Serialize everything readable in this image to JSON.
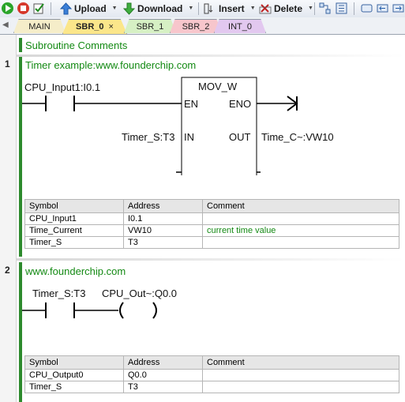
{
  "toolbar": {
    "upload_label": "Upload",
    "download_label": "Download",
    "insert_label": "Insert",
    "delete_label": "Delete"
  },
  "tabs": [
    {
      "label": "MAIN",
      "color": "#f5edc9",
      "active": false
    },
    {
      "label": "SBR_0",
      "color": "#fbe68a",
      "active": true,
      "close": "×"
    },
    {
      "label": "SBR_1",
      "color": "#d6f0c4",
      "active": false
    },
    {
      "label": "SBR_2",
      "color": "#f7c6cc",
      "active": false
    },
    {
      "label": "INT_0",
      "color": "#e2c8ef",
      "active": false
    }
  ],
  "subroutine_comment": "Subroutine Comments",
  "networks": [
    {
      "number": "1",
      "comment": "Timer example:www.founderchip.com",
      "contact_label": "CPU_Input1:I0.1",
      "box_title": "MOV_W",
      "pin_en": "EN",
      "pin_eno": "ENO",
      "pin_in": "IN",
      "pin_out": "OUT",
      "in_operand": "Timer_S:T3",
      "out_operand": "Time_C~:VW10",
      "table": {
        "headers": [
          "Symbol",
          "Address",
          "Comment"
        ],
        "rows": [
          [
            "CPU_Input1",
            "I0.1",
            ""
          ],
          [
            "Time_Current",
            "VW10",
            "current time value"
          ],
          [
            "Timer_S",
            "T3",
            ""
          ]
        ]
      }
    },
    {
      "number": "2",
      "comment": "www.founderchip.com",
      "contact_label": "Timer_S:T3",
      "coil_label": "CPU_Out~:Q0.0",
      "table": {
        "headers": [
          "Symbol",
          "Address",
          "Comment"
        ],
        "rows": [
          [
            "CPU_Output0",
            "Q0.0",
            ""
          ],
          [
            "Timer_S",
            "T3",
            ""
          ]
        ]
      }
    }
  ]
}
